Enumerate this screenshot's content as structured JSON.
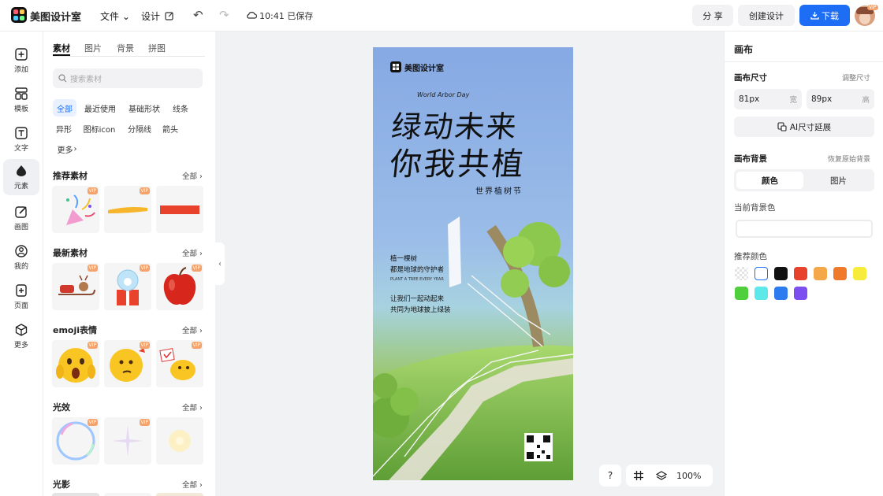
{
  "app": {
    "name": "美图设计室"
  },
  "topbar": {
    "file_menu": "文件",
    "design_menu": "设计",
    "save_status": "10:41 已保存",
    "share_label": "分 享",
    "create_label": "创建设计",
    "download_label": "下载",
    "avatar_badge": "VIP"
  },
  "rail": {
    "items": [
      {
        "label": "添加",
        "icon": "plus-square-icon"
      },
      {
        "label": "模板",
        "icon": "template-icon"
      },
      {
        "label": "文字",
        "icon": "text-icon"
      },
      {
        "label": "元素",
        "icon": "element-icon"
      },
      {
        "label": "画图",
        "icon": "draw-icon"
      },
      {
        "label": "我的",
        "icon": "user-icon"
      },
      {
        "label": "页面",
        "icon": "page-add-icon"
      },
      {
        "label": "更多",
        "icon": "cube-icon"
      }
    ],
    "active": "元素"
  },
  "panel": {
    "tabs": [
      "素材",
      "图片",
      "背景",
      "拼图"
    ],
    "search_placeholder": "搜索素材",
    "chips": [
      "全部",
      "最近使用",
      "基础形状",
      "线条",
      "异形",
      "图标icon",
      "分隔线",
      "箭头",
      "更多"
    ],
    "vip_label": "VIP",
    "sections": [
      {
        "title": "推荐素材",
        "all": "全部"
      },
      {
        "title": "最新素材",
        "all": "全部"
      },
      {
        "title": "emoji表情",
        "all": "全部"
      },
      {
        "title": "光效",
        "all": "全部"
      },
      {
        "title": "光影",
        "all": "全部"
      }
    ]
  },
  "poster": {
    "brand": "美图设计室",
    "english_title": "World Arbor Day",
    "headline_1": "绿动未来",
    "headline_2": "你我共植",
    "subtitle": "世界植树节",
    "body_1": "植一棵树",
    "body_2": "都是地球的守护者",
    "body_3": "PLANT A TREE EVERY YEAR",
    "body_4": "让我们一起动起来",
    "body_5": "共同为地球披上绿装"
  },
  "canvas": {
    "zoom": "100%",
    "help": "?"
  },
  "inspector": {
    "title": "画布",
    "size_label": "画布尺寸",
    "adjust_link": "调整尺寸",
    "width_value": "81px",
    "width_suffix": "宽",
    "height_value": "89px",
    "height_suffix": "高",
    "ai_button": "AI尺寸延展",
    "bg_label": "画布背景",
    "restore_link": "恢复原始背景",
    "seg_color": "颜色",
    "seg_image": "图片",
    "current_bg_label": "当前背景色",
    "recommend_label": "推荐颜色",
    "swatches": [
      "transparent",
      "#ffffff",
      "#111111",
      "#e8412c",
      "#f4a84a",
      "#ef7a2c",
      "#f7ec3c",
      "#4fcf3c",
      "#5ee8ea",
      "#2c7cf0",
      "#7b4ff0"
    ]
  }
}
